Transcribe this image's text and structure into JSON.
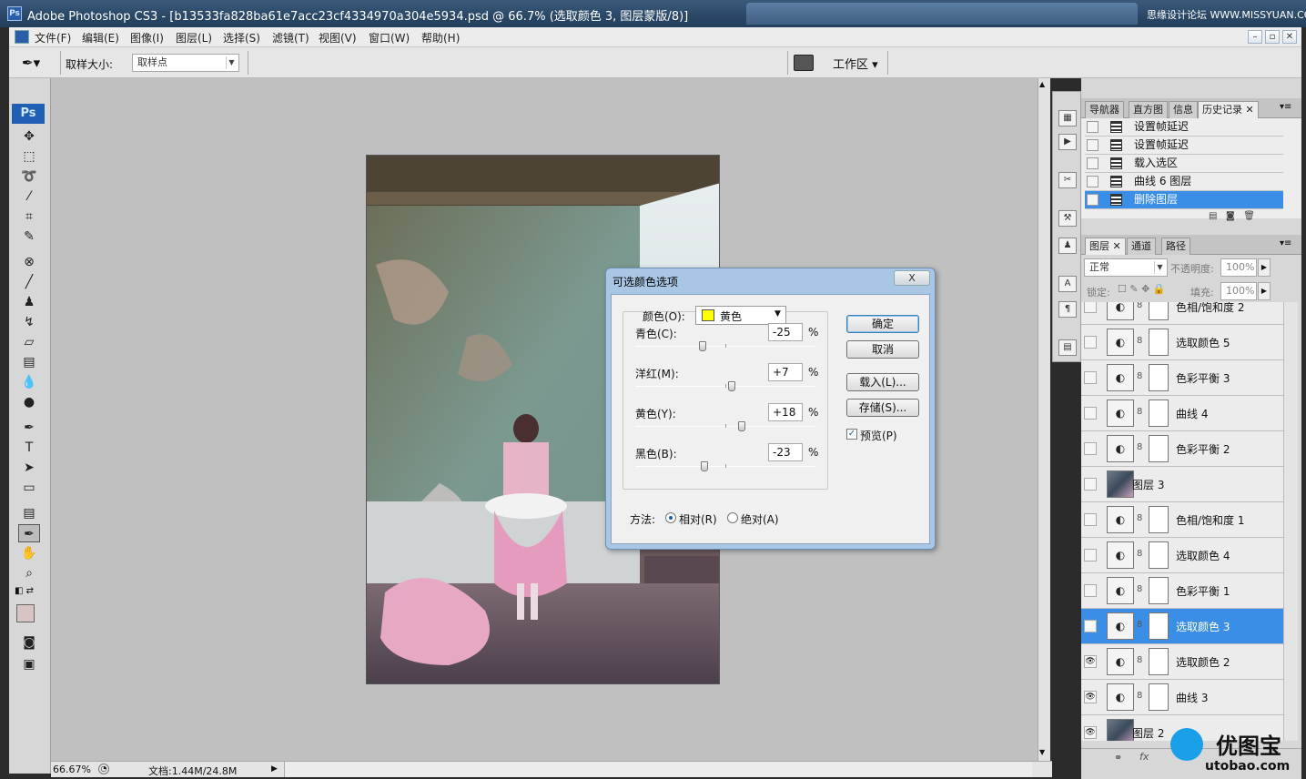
{
  "window": {
    "app_icon": "Ps",
    "title": "Adobe Photoshop CS3 - [b13533fa828ba61e7acc23cf4334970a304e5934.psd @ 66.7% (选取颜色 3, 图层蒙版/8)]",
    "watermark": "思缘设计论坛 WWW.MISSYUAN.COM"
  },
  "menu": [
    "文件(F)",
    "编辑(E)",
    "图像(I)",
    "图层(L)",
    "选择(S)",
    "滤镜(T)",
    "视图(V)",
    "窗口(W)",
    "帮助(H)"
  ],
  "options_bar": {
    "sample_size_label": "取样大小:",
    "sample_size_value": "取样点",
    "workspace_label": "工作区"
  },
  "status": {
    "zoom": "66.67%",
    "doc_info": "文档:1.44M/24.8M"
  },
  "history_panel": {
    "tabs": [
      "导航器",
      "直方图",
      "信息",
      "历史记录"
    ],
    "active_tab": "历史记录",
    "items": [
      "设置帧延迟",
      "设置帧延迟",
      "载入选区",
      "曲线 6 图层",
      "删除图层"
    ],
    "selected_index": 4
  },
  "layers_panel": {
    "tabs": [
      "图层",
      "通道",
      "路径"
    ],
    "blend_mode": "正常",
    "opacity_label": "不透明度:",
    "opacity_value": "100%",
    "lock_label": "锁定:",
    "fill_label": "填充:",
    "fill_value": "100%",
    "layers": [
      {
        "name": "色相/饱和度 2",
        "visible": false,
        "type": "adjust"
      },
      {
        "name": "选取颜色 5",
        "visible": false,
        "type": "adjust"
      },
      {
        "name": "色彩平衡 3",
        "visible": false,
        "type": "adjust"
      },
      {
        "name": "曲线 4",
        "visible": false,
        "type": "adjust"
      },
      {
        "name": "色彩平衡 2",
        "visible": false,
        "type": "adjust"
      },
      {
        "name": "图层 3",
        "visible": false,
        "type": "pixel"
      },
      {
        "name": "色相/饱和度 1",
        "visible": false,
        "type": "adjust"
      },
      {
        "name": "选取颜色 4",
        "visible": false,
        "type": "adjust"
      },
      {
        "name": "色彩平衡 1",
        "visible": false,
        "type": "adjust"
      },
      {
        "name": "选取颜色 3",
        "visible": true,
        "type": "adjust",
        "selected": true
      },
      {
        "name": "选取颜色 2",
        "visible": true,
        "type": "adjust"
      },
      {
        "name": "曲线 3",
        "visible": true,
        "type": "adjust"
      },
      {
        "name": "图层 2",
        "visible": true,
        "type": "pixel"
      }
    ],
    "footer_icons": "fx"
  },
  "dialog": {
    "title": "可选颜色选项",
    "close": "X",
    "colors_label": "颜色(O):",
    "colors_value": "黄色",
    "swatch_color": "#ffff00",
    "sliders": [
      {
        "label": "青色(C):",
        "value": "-25",
        "unit": "%",
        "level": -25
      },
      {
        "label": "洋红(M):",
        "value": "+7",
        "unit": "%",
        "level": 7
      },
      {
        "label": "黄色(Y):",
        "value": "+18",
        "unit": "%",
        "level": 18
      },
      {
        "label": "黑色(B):",
        "value": "-23",
        "unit": "%",
        "level": -23
      }
    ],
    "method_label": "方法:",
    "relative_label": "相对(R)",
    "absolute_label": "绝对(A)",
    "ok_label": "确定",
    "cancel_label": "取消",
    "load_label": "载入(L)...",
    "save_label": "存储(S)...",
    "preview_label": "预览(P)"
  },
  "logo": {
    "text": "优图宝",
    "url_text": "utobao.com"
  }
}
